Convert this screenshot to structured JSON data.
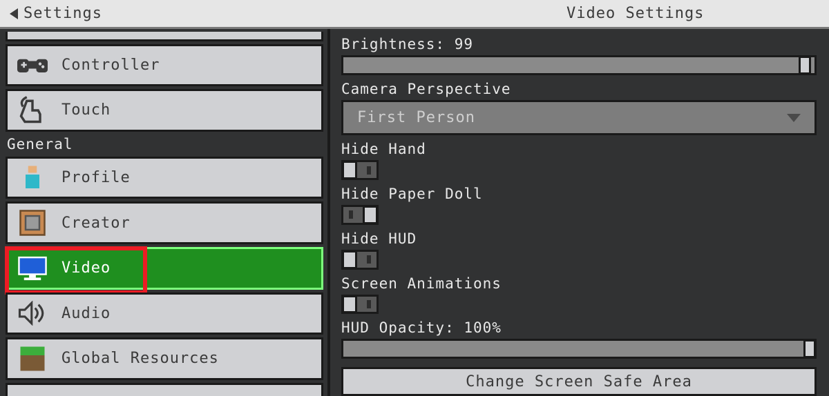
{
  "header": {
    "back_label": "Settings",
    "title": "Video Settings"
  },
  "sidebar": {
    "top_partial_visible": true,
    "items": [
      {
        "id": "controller",
        "label": "Controller",
        "icon": "controller-icon",
        "selected": false
      },
      {
        "id": "touch",
        "label": "Touch",
        "icon": "touch-icon",
        "selected": false
      }
    ],
    "section_label": "General",
    "general_items": [
      {
        "id": "profile",
        "label": "Profile",
        "icon": "profile-icon",
        "selected": false
      },
      {
        "id": "creator",
        "label": "Creator",
        "icon": "command-block-icon",
        "selected": false
      },
      {
        "id": "video",
        "label": "Video",
        "icon": "monitor-icon",
        "selected": true,
        "highlighted": true
      },
      {
        "id": "audio",
        "label": "Audio",
        "icon": "speaker-icon",
        "selected": false
      },
      {
        "id": "global-resources",
        "label": "Global Resources",
        "icon": "grass-block-icon",
        "selected": false
      }
    ],
    "bottom_partial_visible": true
  },
  "pane": {
    "brightness_label": "Brightness: 99",
    "brightness_pct": 99,
    "camera_label": "Camera Perspective",
    "camera_value": "First Person",
    "hide_hand_label": "Hide Hand",
    "hide_hand_on": false,
    "hide_paper_doll_label": "Hide Paper Doll",
    "hide_paper_doll_on": true,
    "hide_hud_label": "Hide HUD",
    "hide_hud_on": false,
    "screen_anim_label": "Screen Animations",
    "screen_anim_on": false,
    "hud_opacity_label": "HUD Opacity: 100%",
    "hud_opacity_pct": 100,
    "bottom_button_label": "Change Screen Safe Area"
  },
  "colors": {
    "selected_bg": "#1f8f1f",
    "highlight_border": "#ec1c24"
  }
}
